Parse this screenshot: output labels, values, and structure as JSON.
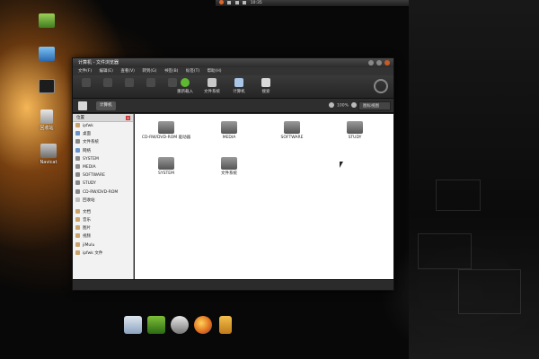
{
  "desktop": {
    "icons": [
      {
        "label": ""
      },
      {
        "label": ""
      },
      {
        "label": ""
      },
      {
        "label": "回收站"
      },
      {
        "label": "Navicat"
      }
    ]
  },
  "topbar": {
    "time": "10:35"
  },
  "window": {
    "title": "计算机 - 文件浏览器",
    "menu": [
      "文件(F)",
      "编辑(E)",
      "查看(V)",
      "转到(G)",
      "书签(B)",
      "标签(T)",
      "帮助(H)"
    ],
    "toolbar": {
      "buttons": [
        "",
        "",
        "",
        "",
        "",
        "重新载入",
        "文件系统",
        "计算机",
        "搜索"
      ]
    },
    "location": {
      "crumb": "计算机",
      "zoom": "100%",
      "view": "图标视图"
    },
    "sidebar": {
      "header": "位置",
      "items": [
        "ipfwk",
        "桌面",
        "文件系统",
        "网络",
        "SYSTEM",
        "MEDIA",
        "SOFTWARE",
        "STUDY",
        "CD-RW/DVD-ROM",
        "回收站",
        "文档",
        "音乐",
        "图片",
        "视频",
        "jiMulu",
        "ipfwk 文件"
      ]
    },
    "files": [
      {
        "label": "CD-RW/DVD-ROM 驱动器"
      },
      {
        "label": "MEDIA"
      },
      {
        "label": "SOFTWARE"
      },
      {
        "label": "STUDY"
      },
      {
        "label": "SYSTEM"
      },
      {
        "label": "文件系统"
      }
    ]
  },
  "colors": {
    "accent": "#e0642a",
    "window_bg": "#2a2a2a",
    "content_bg": "#ffffff",
    "sidebar_bg": "#f2f2f2"
  }
}
